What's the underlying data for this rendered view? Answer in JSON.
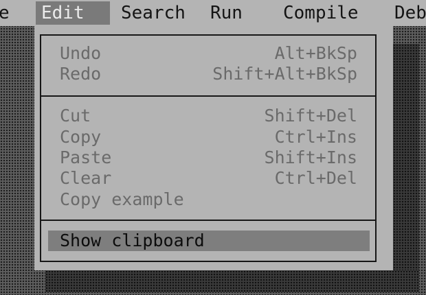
{
  "menubar": {
    "items": [
      {
        "label": "e",
        "active": false
      },
      {
        "label": "Edit",
        "active": true
      },
      {
        "label": "Search",
        "active": false
      },
      {
        "label": "Run",
        "active": false
      },
      {
        "label": "Compile",
        "active": false
      },
      {
        "label": "Deb",
        "active": false
      }
    ]
  },
  "edit_menu": {
    "groups": [
      {
        "items": [
          {
            "label": "Undo",
            "shortcut": "Alt+BkSp"
          },
          {
            "label": "Redo",
            "shortcut": "Shift+Alt+BkSp"
          }
        ]
      },
      {
        "items": [
          {
            "label": "Cut",
            "shortcut": "Shift+Del"
          },
          {
            "label": "Copy",
            "shortcut": "Ctrl+Ins"
          },
          {
            "label": "Paste",
            "shortcut": "Shift+Ins"
          },
          {
            "label": "Clear",
            "shortcut": "Ctrl+Del"
          },
          {
            "label": "Copy example",
            "shortcut": ""
          }
        ]
      },
      {
        "items": [
          {
            "label": "Show clipboard",
            "shortcut": "",
            "selected": true
          }
        ]
      }
    ]
  },
  "colors": {
    "menu_background": "#b4b4b4",
    "highlight": "#7a7a7a",
    "disabled_text": "#6a6a6a",
    "text": "#141414"
  }
}
